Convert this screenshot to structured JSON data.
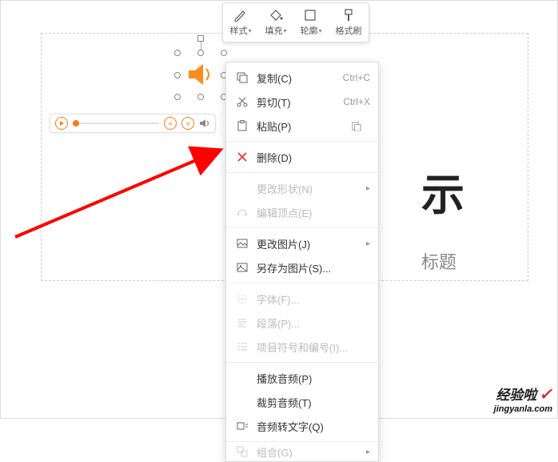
{
  "toolbar": {
    "style": "样式",
    "fill": "填充",
    "outline": "轮廓",
    "format_painter": "格式刷"
  },
  "slide": {
    "title_fragment": "示",
    "subtitle_fragment": "标题"
  },
  "context_menu": {
    "copy": {
      "label": "复制(C)",
      "shortcut": "Ctrl+C"
    },
    "cut": {
      "label": "剪切(T)",
      "shortcut": "Ctrl+X"
    },
    "paste": {
      "label": "粘贴(P)"
    },
    "delete": {
      "label": "删除(D)"
    },
    "change_shape": {
      "label": "更改形状(N)"
    },
    "edit_points": {
      "label": "编辑顶点(E)"
    },
    "change_picture": {
      "label": "更改图片(J)"
    },
    "save_as_picture": {
      "label": "另存为图片(S)..."
    },
    "font": {
      "label": "字体(F)..."
    },
    "paragraph": {
      "label": "段落(P)..."
    },
    "bullets": {
      "label": "项目符号和编号(I)..."
    },
    "play_audio": {
      "label": "播放音频(P)"
    },
    "trim_audio": {
      "label": "裁剪音频(T)"
    },
    "audio_to_text": {
      "label": "音频转文字(Q)"
    },
    "group": {
      "label": "组合(G)"
    }
  },
  "watermark": {
    "name": "经验啦",
    "url": "jingyanla.com"
  }
}
